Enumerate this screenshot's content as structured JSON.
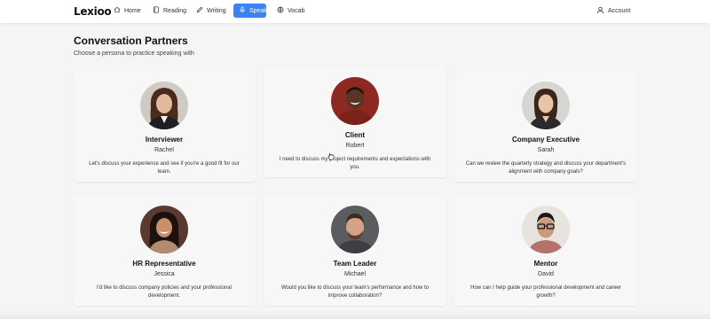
{
  "app": {
    "logo": "Lexioo"
  },
  "nav": {
    "items": [
      {
        "label": "Home",
        "icon": "home-icon"
      },
      {
        "label": "Reading",
        "icon": "book-icon"
      },
      {
        "label": "Writing",
        "icon": "pencil-icon"
      },
      {
        "label": "Speak",
        "icon": "microphone-icon",
        "active": true
      },
      {
        "label": "Vocab",
        "icon": "globe-icon"
      }
    ],
    "account_label": "Account"
  },
  "page": {
    "title": "Conversation Partners",
    "subtitle": "Choose a persona to practice speaking with"
  },
  "partners": [
    {
      "role": "Interviewer",
      "name": "Rachel",
      "quote": "Let's discuss your experience and see if you're a good fit for our team."
    },
    {
      "role": "Client",
      "name": "Robert",
      "quote": "I need to discuss my project requirements and expectations with you."
    },
    {
      "role": "Company Executive",
      "name": "Sarah",
      "quote": "Can we review the quarterly strategy and discuss your department's alignment with company goals?"
    },
    {
      "role": "HR Representative",
      "name": "Jessica",
      "quote": "I'd like to discuss company policies and your professional development."
    },
    {
      "role": "Team Leader",
      "name": "Michael",
      "quote": "Would you like to discuss your team's performance and how to improve collaboration?"
    },
    {
      "role": "Mentor",
      "name": "David",
      "quote": "How can I help guide your professional development and career growth?"
    }
  ],
  "colors": {
    "accent": "#3b82f6",
    "background": "#f5f5f5"
  }
}
